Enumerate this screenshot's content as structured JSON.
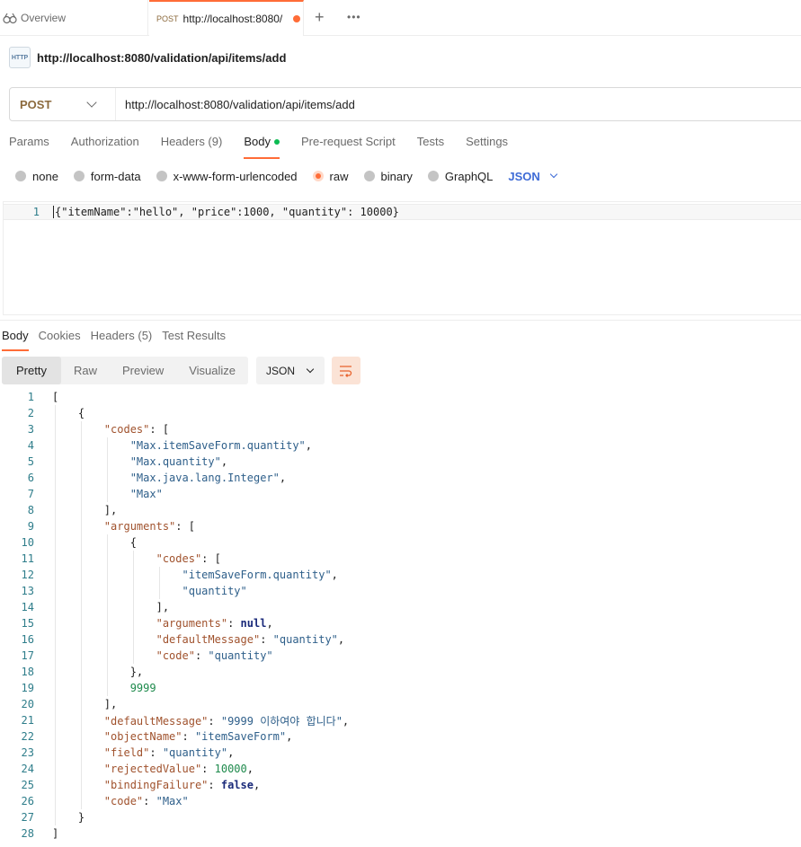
{
  "tabs": {
    "overview_label": "Overview",
    "request_method": "POST",
    "request_url": "http://localhost:8080/",
    "plus": "+",
    "more": "•••"
  },
  "request": {
    "title": "http://localhost:8080/validation/api/items/add",
    "http_icon_text": "HTTP",
    "method": "POST",
    "url": "http://localhost:8080/validation/api/items/add"
  },
  "request_tabs": [
    "Params",
    "Authorization",
    "Headers (9)",
    "Body",
    "Pre-request Script",
    "Tests",
    "Settings"
  ],
  "body_types": {
    "options": [
      "none",
      "form-data",
      "x-www-form-urlencoded",
      "raw",
      "binary",
      "GraphQL"
    ],
    "selected": "raw",
    "language": "JSON"
  },
  "request_body": {
    "line_number": "1",
    "text": "{\"itemName\":\"hello\", \"price\":1000, \"quantity\": 10000}"
  },
  "response_tabs": [
    "Body",
    "Cookies",
    "Headers (5)",
    "Test Results"
  ],
  "response_toolbar": {
    "views": [
      "Pretty",
      "Raw",
      "Preview",
      "Visualize"
    ],
    "active_view": "Pretty",
    "format": "JSON"
  },
  "response_lines": [
    "[",
    "    {",
    "        \"codes\": [",
    "            \"Max.itemSaveForm.quantity\",",
    "            \"Max.quantity\",",
    "            \"Max.java.lang.Integer\",",
    "            \"Max\"",
    "        ],",
    "        \"arguments\": [",
    "            {",
    "                \"codes\": [",
    "                    \"itemSaveForm.quantity\",",
    "                    \"quantity\"",
    "                ],",
    "                \"arguments\": null,",
    "                \"defaultMessage\": \"quantity\",",
    "                \"code\": \"quantity\"",
    "            },",
    "            9999",
    "        ],",
    "        \"defaultMessage\": \"9999 이하여야 합니다\",",
    "        \"objectName\": \"itemSaveForm\",",
    "        \"field\": \"quantity\",",
    "        \"rejectedValue\": 10000,",
    "        \"bindingFailure\": false,",
    "        \"code\": \"Max\"",
    "    }",
    "]"
  ],
  "colors": {
    "accent": "#ff6c37",
    "method": "#8c6a3d",
    "json_key": "#a0522d",
    "json_string": "#2e5f8a",
    "json_number": "#1e8a4c",
    "line_number": "#2e7d8a"
  }
}
